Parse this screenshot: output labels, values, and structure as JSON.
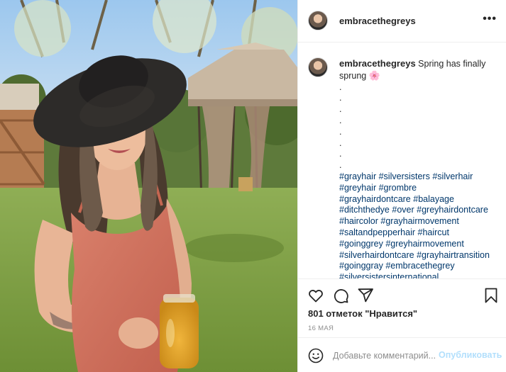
{
  "post": {
    "username": "embracethegreys",
    "more_icon": "more-horizontal-icon"
  },
  "caption": {
    "username": "embracethegreys",
    "text": "Spring has finally sprung",
    "emoji": "🌸",
    "dots": [
      ".",
      ".",
      ".",
      ".",
      ".",
      ".",
      ".",
      "."
    ],
    "hashtag_lines": [
      [
        "#grayhair",
        "#silversisters",
        "#silverhair"
      ],
      [
        "#greyhair",
        "#grombre"
      ],
      [
        "#grayhairdontcare",
        "#balayage"
      ],
      [
        "#ditchthedye",
        "#over",
        "#greyhairdontcare"
      ],
      [
        "#haircolor",
        "#grayhairmovement"
      ],
      [
        "#saltandpepperhair",
        "#haircut"
      ],
      [
        "#goinggrey",
        "#greyhairmovement"
      ],
      [
        "#silverhairdontcare",
        "#grayhairtransition"
      ],
      [
        "#goinggray",
        "#embracethegrey"
      ],
      [
        "#silversistersinternational"
      ]
    ]
  },
  "actions": {
    "icons": [
      "heart-icon",
      "comment-icon",
      "share-icon",
      "bookmark-icon"
    ],
    "likes": "801 отметок \"Нравится\"",
    "date": "16 МАЯ"
  },
  "comment": {
    "placeholder": "Добавьте комментарий...",
    "publish_label": "Опубликовать"
  },
  "colors": {
    "hashtag": "#00376b",
    "publish_disabled": "#b2dffc",
    "border": "#efefef"
  }
}
